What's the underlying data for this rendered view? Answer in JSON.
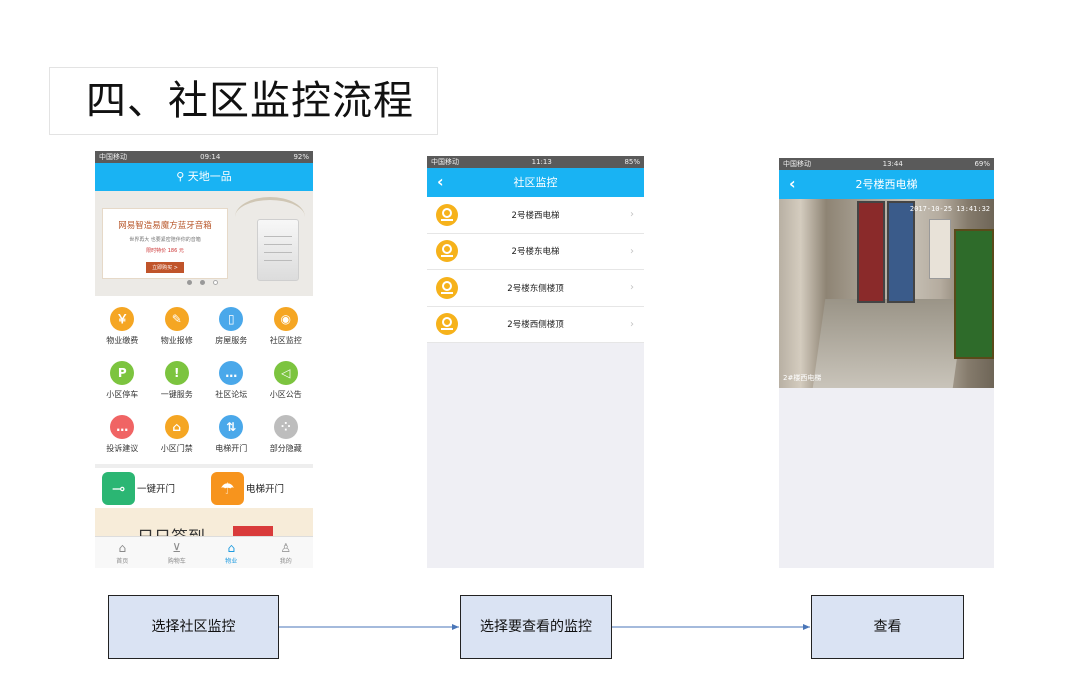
{
  "title": "四、社区监控流程",
  "phone1": {
    "status": {
      "carrier": "中国移动",
      "time": "09:14",
      "battery": "92%"
    },
    "nav_title": "天地一品",
    "banner": {
      "title": "网易智造易魔方蓝牙音箱",
      "subtitle": "世界再大 也要紧密陪伴你的音箱",
      "price": "限时特价 186 元",
      "button": "立即购买 >"
    },
    "grid": [
      {
        "label": "物业缴费",
        "icon": "money-bag-icon",
        "glyph": "￥",
        "color": "#f5a623"
      },
      {
        "label": "物业报修",
        "icon": "wrench-icon",
        "glyph": "✎",
        "color": "#f5a623"
      },
      {
        "label": "房屋服务",
        "icon": "door-icon",
        "glyph": "▯",
        "color": "#4aa8ea"
      },
      {
        "label": "社区监控",
        "icon": "camera-icon",
        "glyph": "◉",
        "color": "#f5a623"
      },
      {
        "label": "小区停车",
        "icon": "parking-icon",
        "glyph": "P",
        "color": "#7cc43f"
      },
      {
        "label": "一键服务",
        "icon": "alert-icon",
        "glyph": "!",
        "color": "#7cc43f"
      },
      {
        "label": "社区论坛",
        "icon": "chat-icon",
        "glyph": "…",
        "color": "#4aa8ea"
      },
      {
        "label": "小区公告",
        "icon": "megaphone-icon",
        "glyph": "◁",
        "color": "#7cc43f"
      },
      {
        "label": "投诉建议",
        "icon": "message-icon",
        "glyph": "…",
        "color": "#f06464"
      },
      {
        "label": "小区门禁",
        "icon": "sofa-icon",
        "glyph": "⌂",
        "color": "#f5a623"
      },
      {
        "label": "电梯开门",
        "icon": "elevator-icon",
        "glyph": "⇅",
        "color": "#4aa8ea"
      },
      {
        "label": "部分隐藏",
        "icon": "more-icon",
        "glyph": "⁘",
        "color": "#bdbdbd"
      }
    ],
    "quick": [
      {
        "label": "一键开门",
        "icon": "key-icon",
        "glyph": "⊸",
        "color": "#2bb673"
      },
      {
        "label": "电梯开门",
        "icon": "umbrella-icon",
        "glyph": "☂",
        "color": "#f7941d"
      }
    ],
    "promo_text": "日日签到",
    "tabs": [
      {
        "label": "首页",
        "icon": "home-icon",
        "glyph": "⌂",
        "active": false
      },
      {
        "label": "购物车",
        "icon": "cart-icon",
        "glyph": "⊻",
        "active": false
      },
      {
        "label": "物业",
        "icon": "property-icon",
        "glyph": "⌂",
        "active": true
      },
      {
        "label": "我的",
        "icon": "person-icon",
        "glyph": "♙",
        "active": false
      }
    ]
  },
  "phone2": {
    "status": {
      "carrier": "中国移动",
      "time": "11:13",
      "battery": "85%"
    },
    "nav_title": "社区监控",
    "items": [
      "2号楼西电梯",
      "2号楼东电梯",
      "2号楼东侧楼顶",
      "2号楼西侧楼顶"
    ]
  },
  "phone3": {
    "status": {
      "carrier": "中国移动",
      "time": "13:44",
      "battery": "69%"
    },
    "nav_title": "2号楼西电梯",
    "timestamp": "2017-10-25 13:41:32",
    "caption": "2#楼西电梯"
  },
  "flow": [
    "选择社区监控",
    "选择要查看的监控",
    "查看"
  ],
  "colors": {
    "nav": "#19b3f3",
    "flow_box": "#dae3f3",
    "arrow": "#4a76b8"
  }
}
